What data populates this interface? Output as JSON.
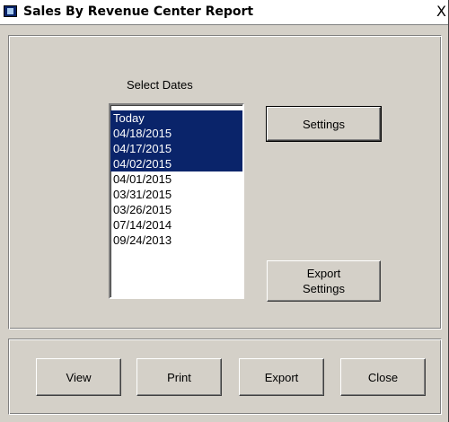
{
  "window": {
    "title": "Sales By Revenue Center Report",
    "close_glyph": "X"
  },
  "dates": {
    "label": "Select Dates",
    "items": [
      {
        "label": "Today",
        "selected": true
      },
      {
        "label": "04/18/2015",
        "selected": true
      },
      {
        "label": "04/17/2015",
        "selected": true
      },
      {
        "label": "04/02/2015",
        "selected": true
      },
      {
        "label": "04/01/2015",
        "selected": false
      },
      {
        "label": "03/31/2015",
        "selected": false
      },
      {
        "label": "03/26/2015",
        "selected": false
      },
      {
        "label": "07/14/2014",
        "selected": false
      },
      {
        "label": "09/24/2013",
        "selected": false
      }
    ]
  },
  "buttons": {
    "settings": "Settings",
    "export_settings_line1": "Export",
    "export_settings_line2": "Settings",
    "view": "View",
    "print": "Print",
    "export": "Export",
    "close": "Close"
  },
  "colors": {
    "face": "#d4d0c8",
    "selection": "#0a246a"
  }
}
